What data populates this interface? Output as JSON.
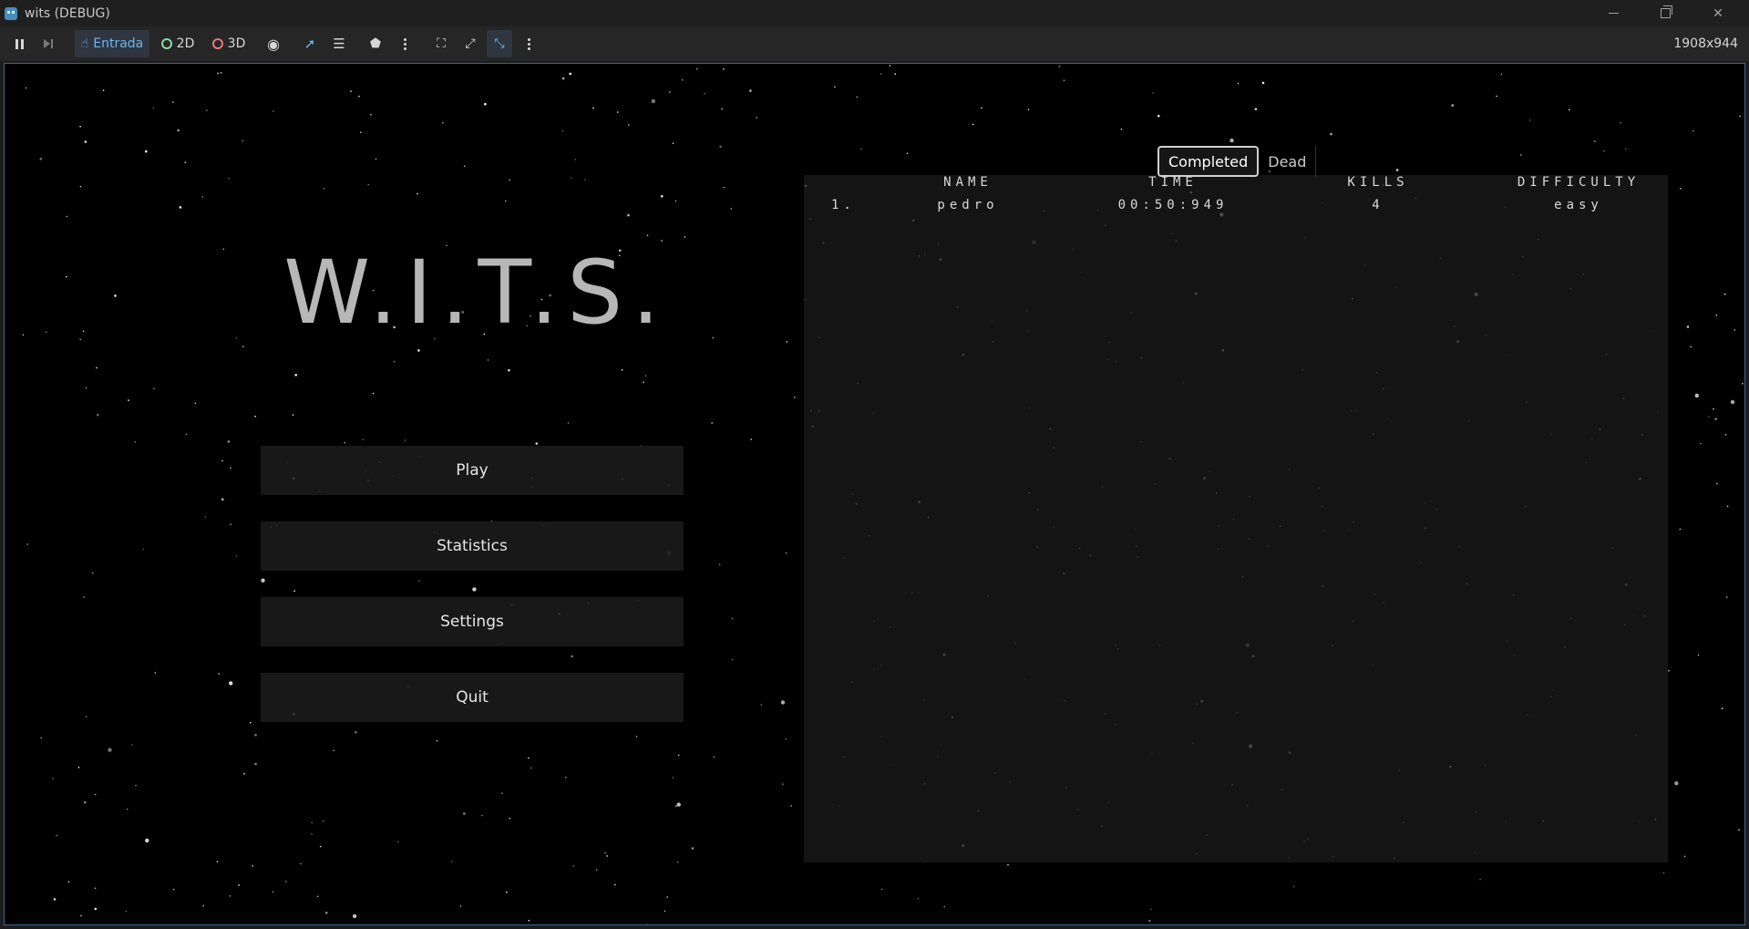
{
  "window": {
    "title": "wits (DEBUG)",
    "icon": "godot-icon"
  },
  "toolbar": {
    "items": [
      {
        "name": "pause",
        "icon": "pause-icon"
      },
      {
        "name": "next-frame",
        "icon": "next-frame-icon"
      },
      {
        "name": "input",
        "label": "Entrada",
        "icon": "input-icon"
      },
      {
        "name": "2d",
        "label": "2D",
        "icon": "circle-icon"
      },
      {
        "name": "3d",
        "label": "3D",
        "icon": "circle-icon"
      }
    ],
    "resolution": "1908x944",
    "accent_color": "#6db4f0"
  },
  "game": {
    "title": "W.I.T.S.",
    "menu": {
      "play": "Play",
      "statistics": "Statistics",
      "settings": "Settings",
      "quit": "Quit"
    },
    "stats": {
      "tabs": [
        "Completed",
        "Dead"
      ],
      "selected_tab": "Completed",
      "columns": [
        "NAME",
        "TIME",
        "KILLS",
        "DIFFICULTY"
      ],
      "rows": [
        {
          "rank": "1.",
          "name": "pedro",
          "time": "00:50:949",
          "kills": "4",
          "difficulty": "easy"
        }
      ]
    }
  }
}
